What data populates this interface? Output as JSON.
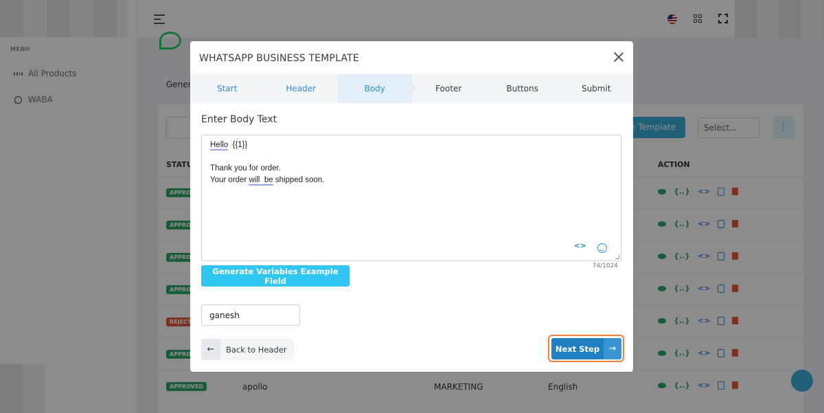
{
  "sidebar": {
    "menu_title": "MENU",
    "items": [
      {
        "label": "All Products",
        "icon": "grid-icon"
      },
      {
        "label": "WABA",
        "icon": "whatsapp-icon"
      }
    ]
  },
  "background": {
    "tab_label": "Gener",
    "create_button": "e Template",
    "select_placeholder": "Select...",
    "columns": {
      "status": "STATU",
      "action": "ACTION"
    },
    "rows": [
      {
        "status": "APPRO"
      },
      {
        "status": "APPRO"
      },
      {
        "status": "APPRO"
      },
      {
        "status": "APPRO"
      },
      {
        "status": "REJECT"
      },
      {
        "status": "APPRO"
      },
      {
        "status": "APPROVED",
        "name": "apollo",
        "category": "MARKETING",
        "language": "English"
      }
    ],
    "action_code_label": "{..}",
    "action_embed_label": "<>"
  },
  "modal": {
    "title": "WHATSAPP BUSINESS TEMPLATE",
    "steps": [
      "Start",
      "Header",
      "Body",
      "Footer",
      "Buttons",
      "Submit"
    ],
    "active_step": "Body",
    "section_label": "Enter Body Text",
    "body_text": {
      "line1_word": "Hello",
      "line1_var": "{{1}}",
      "line2": "Thank you for order.",
      "line3_pre": "Your order ",
      "line3_underlined": "will  be",
      "line3_post": " shipped soon."
    },
    "code_icon_label": "<>",
    "char_counter": "74/1024",
    "generate_button": "Generate Variables Example Field",
    "variable_value": "ganesh",
    "back_button": "Back to Header",
    "next_button": "Next Step",
    "colors": {
      "accent": "#2b8fd1",
      "generate_btn": "#31c5f4",
      "next_btn": "#1f7fc0",
      "highlight_outline": "#f07e3e",
      "approved": "#2fa866",
      "rejected": "#e25a3c"
    }
  }
}
